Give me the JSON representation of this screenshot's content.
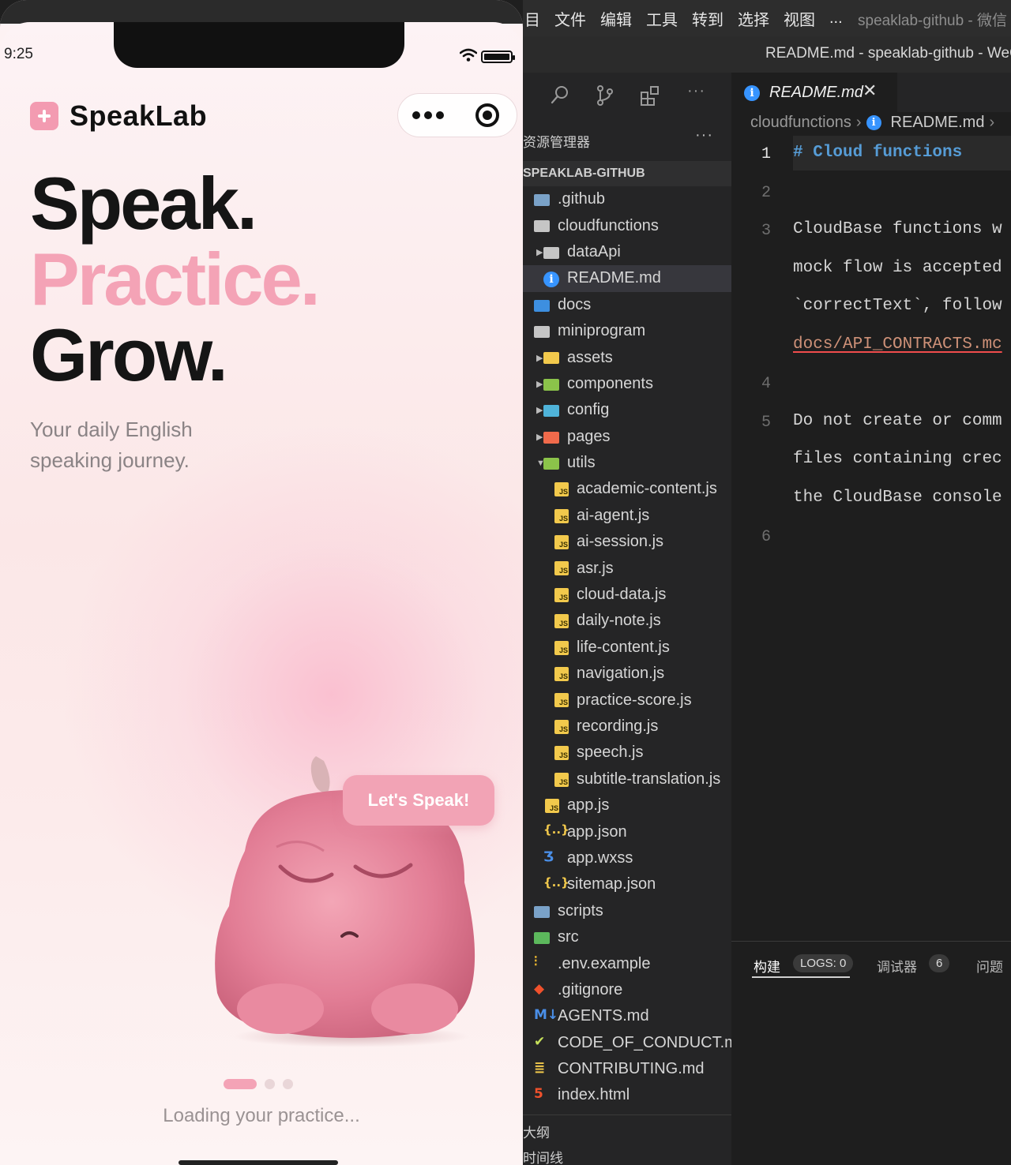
{
  "phone": {
    "status": {
      "time": "9:25"
    },
    "brand": "SpeakLab",
    "hero": {
      "line1": "Speak.",
      "line2": "Practice.",
      "line3": "Grow."
    },
    "tagline": "Your daily English speaking journey.",
    "speech_bubble": "Let's Speak!",
    "loading_text": "Loading your practice...",
    "carousel": {
      "count": 3,
      "active": 0
    },
    "colors": {
      "accent": "#f4a3b6",
      "text": "#151515",
      "muted": "#8a8385"
    }
  },
  "ide": {
    "menu": [
      "目",
      "文件",
      "编辑",
      "工具",
      "转到",
      "选择",
      "视图",
      "..."
    ],
    "window_title": "speaklab-github - 微信",
    "title_bar": "README.md - speaklab-github - WeCh",
    "explorer": {
      "header": "资源管理器",
      "more": "···",
      "root": "SPEAKLAB-GITHUB",
      "items": [
        {
          "name": ".github",
          "type": "folder",
          "color": "#7aa2c8"
        },
        {
          "name": "cloudfunctions",
          "type": "folder",
          "color": "#c5c5c5"
        },
        {
          "name": "dataApi",
          "type": "folder",
          "color": "#c5c5c5"
        },
        {
          "name": "README.md",
          "type": "info",
          "color": "#3794ff"
        },
        {
          "name": "docs",
          "type": "folder",
          "color": "#3d8fe0"
        },
        {
          "name": "miniprogram",
          "type": "folder",
          "color": "#c5c5c5"
        },
        {
          "name": "assets",
          "type": "folder",
          "color": "#f2c94c"
        },
        {
          "name": "components",
          "type": "folder",
          "color": "#8bc34a"
        },
        {
          "name": "config",
          "type": "folder",
          "color": "#4fb3d9"
        },
        {
          "name": "pages",
          "type": "folder",
          "color": "#f06a4b"
        },
        {
          "name": "utils",
          "type": "folder",
          "color": "#8bc34a"
        },
        {
          "name": "academic-content.js",
          "type": "js",
          "color": "#f2c94c"
        },
        {
          "name": "ai-agent.js",
          "type": "js",
          "color": "#f2c94c"
        },
        {
          "name": "ai-session.js",
          "type": "js",
          "color": "#f2c94c"
        },
        {
          "name": "asr.js",
          "type": "js",
          "color": "#f2c94c"
        },
        {
          "name": "cloud-data.js",
          "type": "js",
          "color": "#f2c94c"
        },
        {
          "name": "daily-note.js",
          "type": "js",
          "color": "#f2c94c"
        },
        {
          "name": "life-content.js",
          "type": "js",
          "color": "#f2c94c"
        },
        {
          "name": "navigation.js",
          "type": "js",
          "color": "#f2c94c"
        },
        {
          "name": "practice-score.js",
          "type": "js",
          "color": "#f2c94c"
        },
        {
          "name": "recording.js",
          "type": "js",
          "color": "#f2c94c"
        },
        {
          "name": "speech.js",
          "type": "js",
          "color": "#f2c94c"
        },
        {
          "name": "subtitle-translation.js",
          "type": "js",
          "color": "#f2c94c"
        },
        {
          "name": "app.js",
          "type": "js",
          "color": "#f2c94c"
        },
        {
          "name": "app.json",
          "type": "json",
          "color": "#f2c94c"
        },
        {
          "name": "app.wxss",
          "type": "css",
          "color": "#4a8fe8"
        },
        {
          "name": "sitemap.json",
          "type": "json",
          "color": "#f2c94c"
        },
        {
          "name": "scripts",
          "type": "folder",
          "color": "#7aa2c8"
        },
        {
          "name": "src",
          "type": "folder",
          "color": "#5cb85c"
        },
        {
          "name": ".env.example",
          "type": "env",
          "color": "#e0b030"
        },
        {
          "name": ".gitignore",
          "type": "git",
          "color": "#f0512c"
        },
        {
          "name": "AGENTS.md",
          "type": "md",
          "color": "#4a8fe8"
        },
        {
          "name": "CODE_OF_CONDUCT.md",
          "type": "coc",
          "color": "#c5e05a"
        },
        {
          "name": "CONTRIBUTING.md",
          "type": "contrib",
          "color": "#f2c94c"
        },
        {
          "name": "index.html",
          "type": "html",
          "color": "#f0512c"
        }
      ],
      "bottom": [
        "大纲",
        "时间线"
      ]
    },
    "editor": {
      "tab": "README.md",
      "breadcrumbs": [
        "cloudfunctions",
        "README.md"
      ],
      "lines": [
        {
          "num": "1",
          "text": "# Cloud functions",
          "kind": "h1"
        },
        {
          "num": "2",
          "text": "",
          "kind": "text"
        },
        {
          "num": "3",
          "text": "CloudBase functions w",
          "kind": "text"
        },
        {
          "num": "",
          "text": "mock flow is accepted",
          "kind": "text"
        },
        {
          "num": "",
          "text": "`correctText`, follow",
          "kind": "text"
        },
        {
          "num": "",
          "text": "docs/API_CONTRACTS.mc",
          "kind": "link"
        },
        {
          "num": "4",
          "text": "",
          "kind": "text"
        },
        {
          "num": "5",
          "text": "Do not create or comm",
          "kind": "text"
        },
        {
          "num": "",
          "text": "files containing crec",
          "kind": "text"
        },
        {
          "num": "",
          "text": "the CloudBase console",
          "kind": "text"
        },
        {
          "num": "6",
          "text": "",
          "kind": "text"
        }
      ]
    },
    "panel": {
      "tabs": [
        {
          "label": "构建",
          "badge": "LOGS: 0"
        },
        {
          "label": "调试器",
          "badge": "6"
        },
        {
          "label": "问题",
          "badge": ""
        }
      ]
    }
  }
}
